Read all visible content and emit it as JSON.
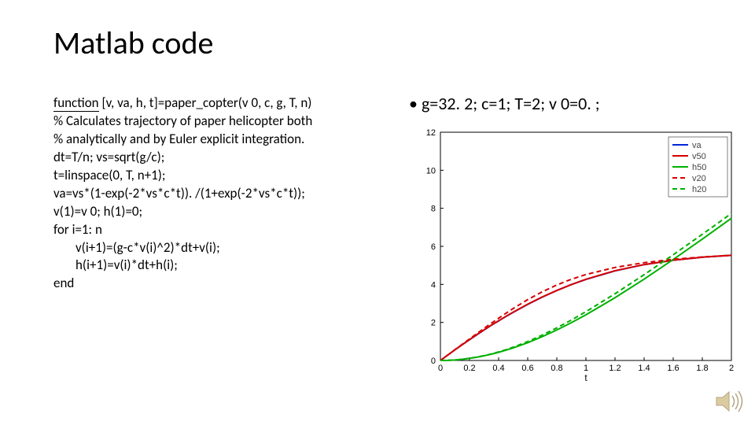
{
  "title": "Matlab code",
  "code": {
    "kw_function": "function",
    "sig": " [v, va, h, t]=paper_copter(v 0, c, g, T, n)",
    "c1": "% Calculates trajectory of paper helicopter both",
    "c2": "% analytically and by  Euler explicit integration.",
    "l1": "dt=T/n; vs=sqrt(g/c);",
    "l2": "t=linspace(0, T, n+1);",
    "l3": "va=vs*(1-exp(-2*vs*c*t)). /(1+exp(-2*vs*c*t));",
    "l4": "v(1)=v 0; h(1)=0;",
    "l5": "for i=1: n",
    "l6": "v(i+1)=(g-c*v(i)^2)*dt+v(i);",
    "l7": "h(i+1)=v(i)*dt+h(i);",
    "l8": "end"
  },
  "params": "g=32. 2; c=1; T=2; v 0=0. ;",
  "chart_data": {
    "type": "line",
    "xlabel": "t",
    "ylabel": "",
    "xlim": [
      0,
      2
    ],
    "ylim": [
      0,
      12
    ],
    "xticks": [
      0,
      0.2,
      0.4,
      0.6,
      0.8,
      1,
      1.2,
      1.4,
      1.6,
      1.8,
      2
    ],
    "yticks": [
      0,
      2,
      4,
      6,
      8,
      10,
      12
    ],
    "legend": [
      "va",
      "v50",
      "h50",
      "v20",
      "h20"
    ],
    "colors": {
      "va": "#0026d6",
      "v50": "#d60000",
      "h50": "#00b000",
      "v20": "#d60000",
      "h20": "#00b000"
    },
    "dash": {
      "va": "",
      "v50": "",
      "h50": "",
      "v20": "6,4",
      "h20": "6,4"
    },
    "x": [
      0,
      0.05,
      0.1,
      0.15,
      0.2,
      0.25,
      0.3,
      0.35,
      0.4,
      0.45,
      0.5,
      0.6,
      0.7,
      0.8,
      0.9,
      1.0,
      1.2,
      1.4,
      1.6,
      1.8,
      2.0
    ],
    "series": [
      {
        "name": "va",
        "y": [
          0.0,
          0.28,
          0.56,
          0.83,
          1.09,
          1.35,
          1.6,
          1.85,
          2.08,
          2.31,
          2.53,
          2.95,
          3.33,
          3.68,
          3.99,
          4.26,
          4.71,
          5.04,
          5.27,
          5.43,
          5.53
        ]
      },
      {
        "name": "v50",
        "y": [
          0.0,
          0.28,
          0.56,
          0.83,
          1.1,
          1.36,
          1.61,
          1.86,
          2.09,
          2.32,
          2.54,
          2.96,
          3.34,
          3.68,
          3.99,
          4.27,
          4.72,
          5.04,
          5.27,
          5.43,
          5.53
        ]
      },
      {
        "name": "h50",
        "y": [
          0.0,
          0.007,
          0.028,
          0.063,
          0.111,
          0.172,
          0.246,
          0.332,
          0.43,
          0.54,
          0.661,
          0.936,
          1.251,
          1.602,
          1.986,
          2.399,
          3.299,
          4.276,
          5.308,
          6.379,
          7.476
        ]
      },
      {
        "name": "v20",
        "y": [
          0.0,
          0.28,
          0.57,
          0.85,
          1.13,
          1.41,
          1.69,
          1.96,
          2.22,
          2.48,
          2.73,
          3.2,
          3.61,
          3.97,
          4.27,
          4.52,
          4.89,
          5.14,
          5.32,
          5.44,
          5.53
        ]
      },
      {
        "name": "h20",
        "y": [
          0.0,
          0.007,
          0.028,
          0.064,
          0.113,
          0.177,
          0.254,
          0.345,
          0.45,
          0.567,
          0.698,
          0.994,
          1.335,
          1.714,
          2.126,
          2.565,
          3.508,
          4.511,
          5.557,
          6.633,
          7.731
        ]
      }
    ]
  }
}
